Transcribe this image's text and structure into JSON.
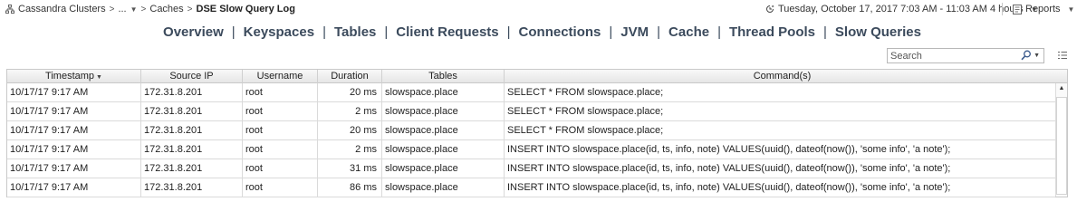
{
  "breadcrumb": {
    "items": [
      "Cassandra Clusters",
      "...",
      "Caches"
    ],
    "current": "DSE Slow Query Log"
  },
  "time_range": {
    "label": "Tuesday, October 17, 2017 7:03 AM - 11:03 AM 4 hours"
  },
  "reports": {
    "label": "Reports"
  },
  "nav": {
    "items": [
      "Overview",
      "Keyspaces",
      "Tables",
      "Client Requests",
      "Connections",
      "JVM",
      "Cache",
      "Thread Pools",
      "Slow Queries"
    ],
    "separator": "|"
  },
  "search": {
    "placeholder": "Search"
  },
  "table": {
    "columns": [
      "Timestamp",
      "Source IP",
      "Username",
      "Duration",
      "Tables",
      "Command(s)"
    ],
    "sorted_column": "Timestamp",
    "rows": [
      {
        "timestamp": "10/17/17 9:17 AM",
        "source_ip": "172.31.8.201",
        "username": "root",
        "duration": "20 ms",
        "tables": "slowspace.place",
        "command": "SELECT * FROM slowspace.place;"
      },
      {
        "timestamp": "10/17/17 9:17 AM",
        "source_ip": "172.31.8.201",
        "username": "root",
        "duration": "2 ms",
        "tables": "slowspace.place",
        "command": "SELECT * FROM slowspace.place;"
      },
      {
        "timestamp": "10/17/17 9:17 AM",
        "source_ip": "172.31.8.201",
        "username": "root",
        "duration": "20 ms",
        "tables": "slowspace.place",
        "command": "SELECT * FROM slowspace.place;"
      },
      {
        "timestamp": "10/17/17 9:17 AM",
        "source_ip": "172.31.8.201",
        "username": "root",
        "duration": "2 ms",
        "tables": "slowspace.place",
        "command": "INSERT INTO slowspace.place(id, ts, info, note) VALUES(uuid(), dateof(now()), 'some info', 'a note');"
      },
      {
        "timestamp": "10/17/17 9:17 AM",
        "source_ip": "172.31.8.201",
        "username": "root",
        "duration": "31 ms",
        "tables": "slowspace.place",
        "command": "INSERT INTO slowspace.place(id, ts, info, note) VALUES(uuid(), dateof(now()), 'some info', 'a note');"
      },
      {
        "timestamp": "10/17/17 9:17 AM",
        "source_ip": "172.31.8.201",
        "username": "root",
        "duration": "86 ms",
        "tables": "slowspace.place",
        "command": "INSERT INTO slowspace.place(id, ts, info, note) VALUES(uuid(), dateof(now()), 'some info', 'a note');"
      }
    ]
  },
  "icons": {
    "breadcrumb": "hierarchy-icon",
    "time": "time-range-icon",
    "reports": "reports-icon",
    "search": "search-icon",
    "menu": "grid-menu-icon"
  },
  "colors": {
    "nav_text": "#3b4a5c",
    "grid_border": "#c9c9c9",
    "header_bg": "#eeeeee"
  }
}
